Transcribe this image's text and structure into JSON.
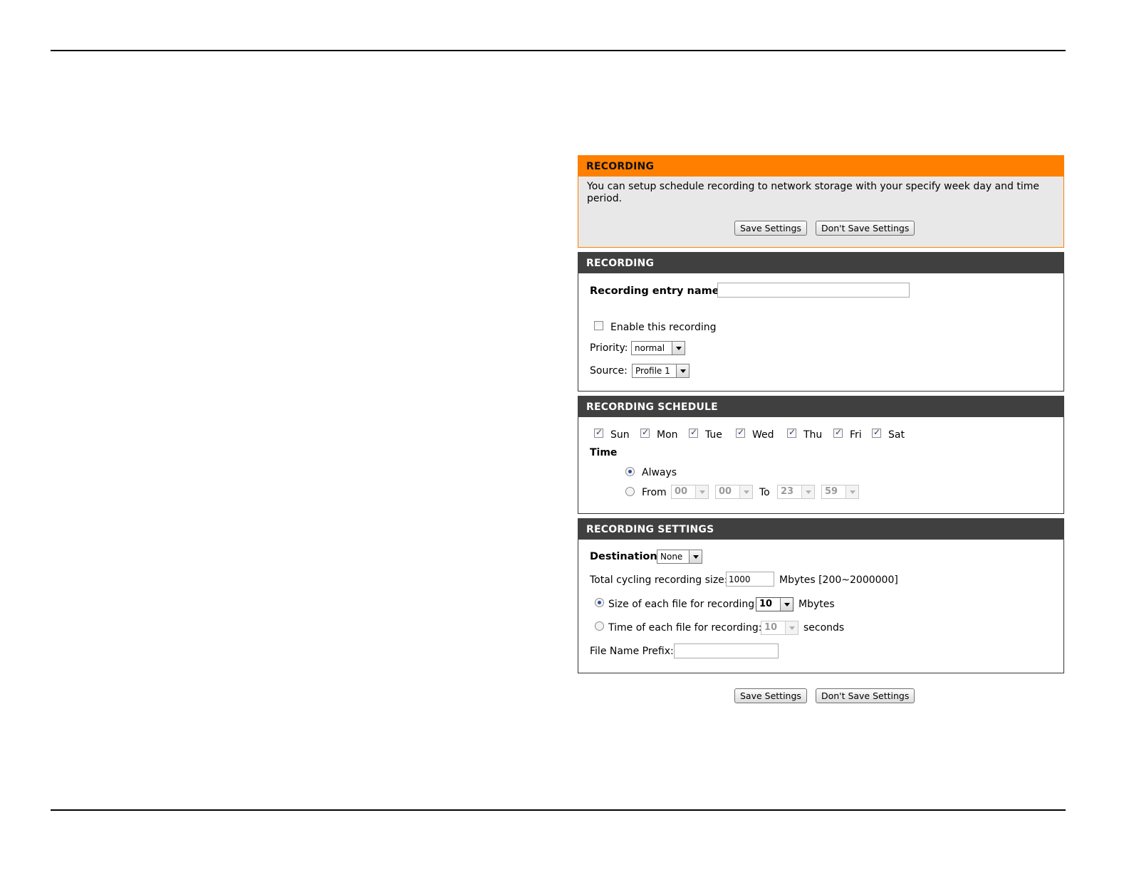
{
  "intro": {
    "title": "RECORDING",
    "description": "You can setup schedule recording to network storage with your specify week day and time period.",
    "save_label": "Save Settings",
    "dont_save_label": "Don't Save Settings"
  },
  "recording": {
    "title": "RECORDING",
    "entry_name_label": "Recording entry name:",
    "entry_name_value": "",
    "enable_label": "Enable this recording",
    "enable_checked": false,
    "priority_label": "Priority:",
    "priority_value": "normal",
    "source_label": "Source:",
    "source_value": "Profile 1"
  },
  "schedule": {
    "title": "RECORDING SCHEDULE",
    "days": [
      {
        "label": "Sun",
        "checked": true
      },
      {
        "label": "Mon",
        "checked": true
      },
      {
        "label": "Tue",
        "checked": true
      },
      {
        "label": "Wed",
        "checked": true
      },
      {
        "label": "Thu",
        "checked": true
      },
      {
        "label": "Fri",
        "checked": true
      },
      {
        "label": "Sat",
        "checked": true
      }
    ],
    "time_label": "Time",
    "always_label": "Always",
    "always_selected": true,
    "from_label": "From",
    "to_label": "To",
    "from_hour": "00",
    "from_min": "00",
    "to_hour": "23",
    "to_min": "59"
  },
  "settings": {
    "title": "RECORDING SETTINGS",
    "destination_label": "Destination",
    "destination_value": "None",
    "cycling_label": "Total cycling recording size:",
    "cycling_value": "1000",
    "cycling_unit": "Mbytes [200~2000000]",
    "size_label": "Size of each file for recording:",
    "size_value": "10",
    "size_unit": "Mbytes",
    "size_selected": true,
    "time_label": "Time of each file for recording:",
    "time_value": "10",
    "time_unit": "seconds",
    "prefix_label": "File Name Prefix:",
    "prefix_value": ""
  },
  "bottom": {
    "save_label": "Save Settings",
    "dont_save_label": "Don't Save Settings"
  }
}
